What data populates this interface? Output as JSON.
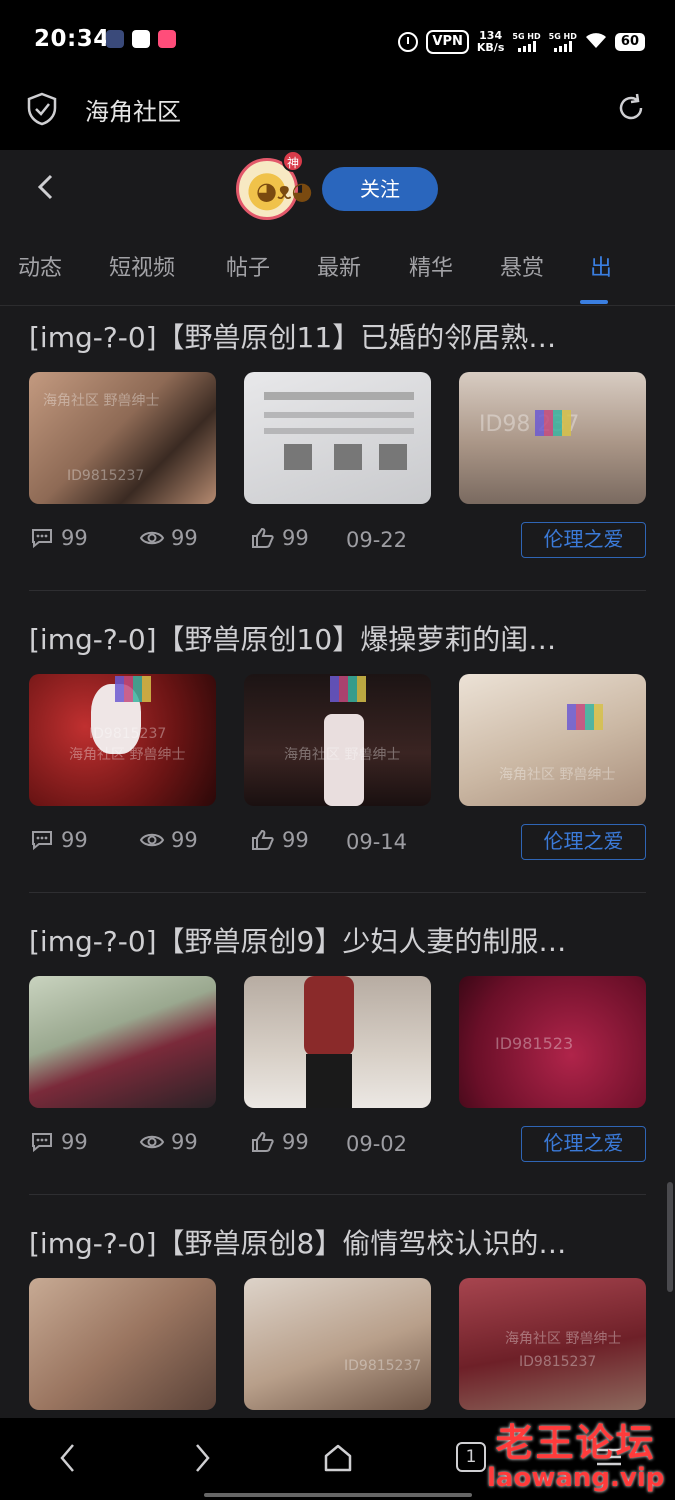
{
  "status_bar": {
    "time": "20:34",
    "vpn": "VPN",
    "speed_value": "134",
    "speed_unit": "KB/s",
    "net1": "5G HD",
    "net2": "5G HD",
    "battery": "60"
  },
  "browser": {
    "title": "海角社区"
  },
  "profile": {
    "badge": "神",
    "follow_label": "关注"
  },
  "tabs": [
    {
      "label": "动态"
    },
    {
      "label": "短视频"
    },
    {
      "label": "帖子"
    },
    {
      "label": "最新"
    },
    {
      "label": "精华"
    },
    {
      "label": "悬赏"
    },
    {
      "label": "出",
      "active": true
    }
  ],
  "posts": [
    {
      "title": "[img-?-0]【野兽原创11】已婚的邻居熟…",
      "thumb_watermarks": [
        "海角社区 野兽绅士",
        "ID9815237",
        "",
        "ID98 237"
      ],
      "comments": "99",
      "views": "99",
      "likes": "99",
      "date": "09-22",
      "tag": "伦理之爱"
    },
    {
      "title": "[img-?-0]【野兽原创10】爆操萝莉的闺…",
      "thumb_watermarks": [
        "海角社区 野兽绅士",
        "ID9815237",
        "海角社区 野兽绅士",
        "海角社区 野兽绅士"
      ],
      "comments": "99",
      "views": "99",
      "likes": "99",
      "date": "09-14",
      "tag": "伦理之爱"
    },
    {
      "title": "[img-?-0]【野兽原创9】少妇人妻的制服…",
      "thumb_watermarks": [
        "",
        "",
        "",
        "ID981523"
      ],
      "comments": "99",
      "views": "99",
      "likes": "99",
      "date": "09-02",
      "tag": "伦理之爱"
    },
    {
      "title": "[img-?-0]【野兽原创8】偷情驾校认识的…",
      "thumb_watermarks": [
        "",
        "",
        "ID9815237",
        "海角社区 野兽绅士",
        "ID9815237"
      ],
      "comments": "",
      "views": "",
      "likes": "",
      "date": "",
      "tag": ""
    }
  ],
  "navbar": {
    "tabs_count": "1"
  },
  "watermark": {
    "cn": "老王论坛",
    "en": "laowang.vip"
  },
  "colors": {
    "accent": "#2a66bd",
    "background": "#1a1a1c",
    "tag_border": "#2f65b5"
  }
}
